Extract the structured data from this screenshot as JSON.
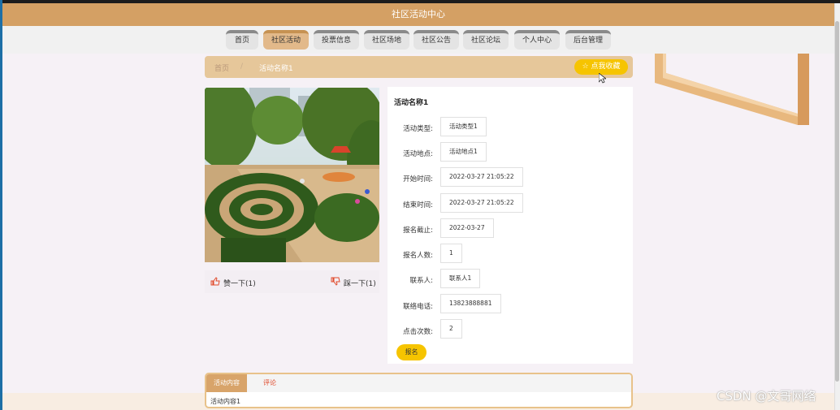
{
  "header": {
    "title": "社区活动中心"
  },
  "nav": {
    "items": [
      {
        "label": "首页"
      },
      {
        "label": "社区活动"
      },
      {
        "label": "投票信息"
      },
      {
        "label": "社区场地"
      },
      {
        "label": "社区公告"
      },
      {
        "label": "社区论坛"
      },
      {
        "label": "个人中心"
      },
      {
        "label": "后台管理"
      }
    ],
    "active_index": 1
  },
  "breadcrumb": {
    "home": "首页",
    "separator": "/",
    "current": "活动名称1"
  },
  "favorite": {
    "label": "☆ 点我收藏"
  },
  "votes": {
    "like": "赞一下(1)",
    "dislike": "踩一下(1)"
  },
  "detail": {
    "name": "活动名称1",
    "fields": [
      {
        "label": "活动类型:",
        "value": "活动类型1"
      },
      {
        "label": "活动地点:",
        "value": "活动地点1"
      },
      {
        "label": "开始时间:",
        "value": "2022-03-27 21:05:22"
      },
      {
        "label": "结束时间:",
        "value": "2022-03-27 21:05:22"
      },
      {
        "label": "报名截止:",
        "value": "2022-03-27"
      },
      {
        "label": "报名人数:",
        "value": "1"
      },
      {
        "label": "联系人:",
        "value": "联系人1"
      },
      {
        "label": "联络电话:",
        "value": "13823888881"
      },
      {
        "label": "点击次数:",
        "value": "2"
      }
    ],
    "signup_label": "报名"
  },
  "tabs": {
    "content_label": "活动内容",
    "comment_label": "评论",
    "content_text": "活动内容1"
  },
  "watermark": "CSDN @文哥网络",
  "colors": {
    "brand": "#d4a064",
    "accent": "#f6c400",
    "comment": "#e04a2b"
  }
}
